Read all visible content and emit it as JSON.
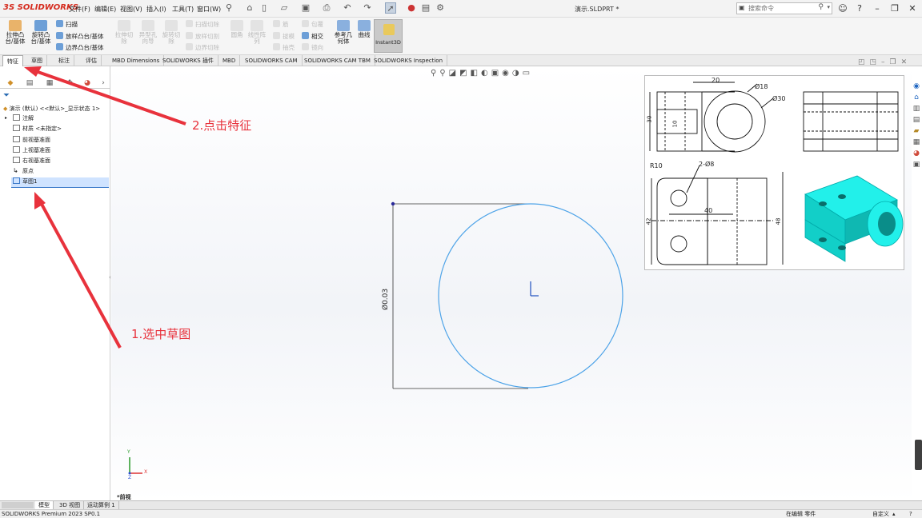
{
  "app": {
    "brand_ds": "3S",
    "brand_name": "SOLIDWORKS",
    "doc_title": "演示.SLDPRT *"
  },
  "menu": [
    "文件(F)",
    "编辑(E)",
    "视图(V)",
    "插入(I)",
    "工具(T)",
    "窗口(W)"
  ],
  "search": {
    "placeholder": "搜索命令",
    "cmd_icon": "command-prompt-icon"
  },
  "commands": {
    "extrude_boss": "拉伸凸\n台/基体",
    "revolve_boss": "旋转凸\n台/基体",
    "sweep": "扫描",
    "loft": "放样凸台/基体",
    "boundary": "边界凸台/基体",
    "extrude_cut": "拉伸切\n除",
    "hole_wizard": "异型孔\n向导",
    "revolve_cut": "旋转切\n除",
    "sweep_cut": "扫描切除",
    "loft_cut": "放样切割",
    "boundary_cut": "边界切除",
    "fillet": "圆角",
    "linear_pattern": "线性阵\n列",
    "rib": "筋",
    "draft": "拔模",
    "shell": "抽壳",
    "wrap": "包覆",
    "intersect": "相交",
    "mirror": "镜向",
    "ref_geometry": "参考几\n何体",
    "curves": "曲线",
    "instant3d": "Instant3D"
  },
  "tabs": [
    "特征",
    "草图",
    "标注",
    "评估",
    "MBD Dimensions",
    "SOLIDWORKS 插件",
    "MBD",
    "SOLIDWORKS CAM",
    "SOLIDWORKS CAM TBM",
    "SOLIDWORKS Inspection"
  ],
  "tree": {
    "root": "演示 (默认) <<默认>_显示状态 1>",
    "items": [
      "注解",
      "材质 <未指定>",
      "前视基准面",
      "上视基准面",
      "右视基准面",
      "原点",
      "草图1"
    ]
  },
  "sketch": {
    "diameter_label": "Ø0.03"
  },
  "drawing": {
    "dim_20": "20",
    "dim_d18": "Ø18",
    "dim_d30": "Ø30",
    "dim_30": "30",
    "dim_10": "10",
    "dim_r10": "R10",
    "dim_2d8": "2-Ø8",
    "dim_40": "40",
    "dim_42": "42",
    "dim_48": "48"
  },
  "annotations": {
    "step1": "1.选中草图",
    "step2": "2.点击特征"
  },
  "triad": {
    "x": "X",
    "y": "Y",
    "z": "Z"
  },
  "preview_label": "*前视",
  "bottom_tabs": [
    "模型",
    "3D 视图",
    "运动算例 1"
  ],
  "status": {
    "product": "SOLIDWORKS Premium 2023 SP0.1",
    "editing": "在编辑 零件",
    "custom": "自定义"
  },
  "colors": {
    "accent": "#d52b1e",
    "sketch": "#4da3e8",
    "annotation": "#e8323c",
    "part": "#19e6e0"
  }
}
